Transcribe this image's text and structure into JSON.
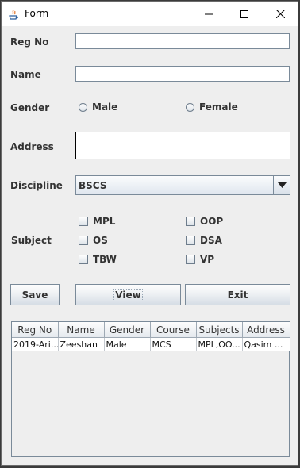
{
  "window": {
    "title": "Form"
  },
  "form": {
    "reg_no_label": "Reg No",
    "reg_no_value": "",
    "name_label": "Name",
    "name_value": "",
    "gender_label": "Gender",
    "gender_options": [
      "Male",
      "Female"
    ],
    "address_label": "Address",
    "address_value": "",
    "discipline_label": "Discipline",
    "discipline_selected": "BSCS",
    "subject_label": "Subject",
    "subjects": [
      "MPL",
      "OOP",
      "OS",
      "DSA",
      "TBW",
      "VP"
    ]
  },
  "buttons": {
    "save": "Save",
    "view": "View",
    "exit": "Exit"
  },
  "table": {
    "columns": [
      "Reg No",
      "Name",
      "Gender",
      "Course",
      "Subjects",
      "Address"
    ],
    "rows": [
      [
        "2019-Ari...",
        "Zeeshan",
        "Male",
        "MCS",
        "MPL,OO...",
        "Qasim ..."
      ]
    ]
  },
  "colors": {
    "window_bg": "#eeeeee",
    "border": "#7a8a99",
    "text": "#333333"
  }
}
